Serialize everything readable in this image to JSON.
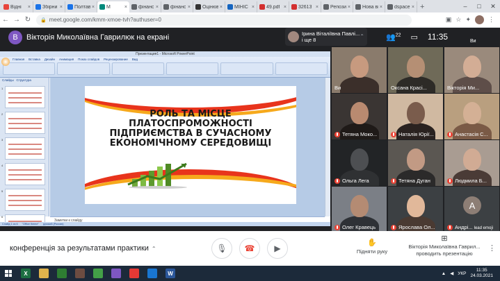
{
  "browser": {
    "tabs": [
      {
        "label": "Відні",
        "color": "#e8453c"
      },
      {
        "label": "Збірни",
        "color": "#1a73e8"
      },
      {
        "label": "Полтав",
        "color": "#1a73e8"
      },
      {
        "label": "М",
        "color": "#00897b",
        "active": true
      },
      {
        "label": "фінанс",
        "color": "#5f6368"
      },
      {
        "label": "фінанс",
        "color": "#5f6368"
      },
      {
        "label": "Оцінюв",
        "color": "#333"
      },
      {
        "label": "МІНІС",
        "color": "#1565c0"
      },
      {
        "label": "49.pdf",
        "color": "#d32f2f"
      },
      {
        "label": "32613",
        "color": "#d32f2f"
      },
      {
        "label": "Репози",
        "color": "#5f6368"
      },
      {
        "label": "Нова вклад",
        "color": "#5f6368"
      },
      {
        "label": "dspace",
        "color": "#5f6368"
      }
    ],
    "new_tab": "+",
    "url": "meet.google.com/kmm-xmoe-tvh?authuser=0"
  },
  "meet": {
    "presenter_initial": "В",
    "presenter_label": "Вікторія Миколаївна Гаврилюк на екрані",
    "pinned_name_line1": "Ірина Віталіївна Павлі...",
    "pinned_name_line2": "і ще 8",
    "people_count": "22",
    "time": "11:35",
    "corner_label": "Ви",
    "emoji_badge": "lead emoji"
  },
  "slide": {
    "window_title": "Презентация1 - Microsoft PowerPoint",
    "ribbon_tabs": [
      "Главная",
      "Вставка",
      "Дизайн",
      "Анимация",
      "Показ слайдов",
      "Рецензирование",
      "Вид"
    ],
    "side_tabs": [
      "Слайды",
      "Структура"
    ],
    "title": "РОЛЬ ТА МІСЦЕ\nПЛАТОСПРОМОЖНОСТІ\nПІДПРИЄМСТВА В СУЧАСНОМУ\nЕКОНОМІЧНОМУ СЕРЕДОВИЩІ",
    "notes": "Заметки к слайду",
    "status": [
      "Слайд 1 из 6",
      "\"Office theme\"",
      "русский (Россия)"
    ],
    "thumb_numbers": [
      "1",
      "2",
      "3",
      "4",
      "5",
      "6"
    ]
  },
  "participants": [
    {
      "name": "Ви",
      "muted": false,
      "bg": "#8a7b6c",
      "face": "#c79a7f",
      "body": "#3b2f2a"
    },
    {
      "name": "Оксана Красі...",
      "muted": false,
      "bg": "#6f6a58",
      "face": "#b58f74",
      "body": "#2d2b27"
    },
    {
      "name": "Вікторія Ми...",
      "muted": false,
      "bg": "#9a8a7c",
      "face": "#d3ad95",
      "body": "#5e4e49"
    },
    {
      "name": "Тетяна Моко...",
      "muted": true,
      "bg": "#3a3533",
      "face": "#b98a70",
      "body": "#1f1a18"
    },
    {
      "name": "Наталія Юрії...",
      "muted": true,
      "bg": "#d0b9a1",
      "face": "#7a5c4c",
      "body": "#2a2220"
    },
    {
      "name": "Анастасія С...",
      "muted": true,
      "bg": "#b99f7f",
      "face": "#d4b095",
      "body": "#7a5a46"
    },
    {
      "name": "Ольга Лега",
      "muted": true,
      "bg": "#222426",
      "face": "#4d4f52",
      "body": "#2f3133"
    },
    {
      "name": "Тетяна Дуган",
      "muted": true,
      "bg": "#5b5752",
      "face": "#c29a84",
      "body": "#2b2a2a"
    },
    {
      "name": "Людмила Б...",
      "muted": true,
      "bg": "#a99c92",
      "face": "#d1ab94",
      "body": "#4a3b36"
    },
    {
      "name": "Олег Кравець",
      "muted": true,
      "bg": "#7b7f86",
      "face": "#b48b73",
      "body": "#2e3136"
    },
    {
      "name": "Ярослава Ол...",
      "muted": true,
      "bg": "#3c4043",
      "face": "#e1b89a",
      "body": "#4a3a32"
    },
    {
      "name": "Андрі...",
      "muted": true,
      "bg": "#3c4043",
      "letter": "А"
    }
  ],
  "bottom": {
    "meeting_name": "конференція за результатами практики",
    "raise_hand": "Підняти руку",
    "present_line1": "Вікторія Миколаївна Гаврил...",
    "present_line2": "проводить презентацію"
  },
  "taskbar": {
    "apps": [
      {
        "label": "X",
        "color": "#1d6f42"
      },
      {
        "label": "",
        "color": "#e0b34c"
      },
      {
        "label": "",
        "color": "#2e7d32"
      },
      {
        "label": "",
        "color": "#6d4c41"
      },
      {
        "label": "",
        "color": "#43a047"
      },
      {
        "label": "",
        "color": "#7e57c2"
      },
      {
        "label": "",
        "color": "#e53935"
      },
      {
        "label": "",
        "color": "#1976d2"
      },
      {
        "label": "W",
        "color": "#2b579a"
      }
    ],
    "lang": "УКР",
    "time": "11:35",
    "date": "24.03.2021"
  }
}
